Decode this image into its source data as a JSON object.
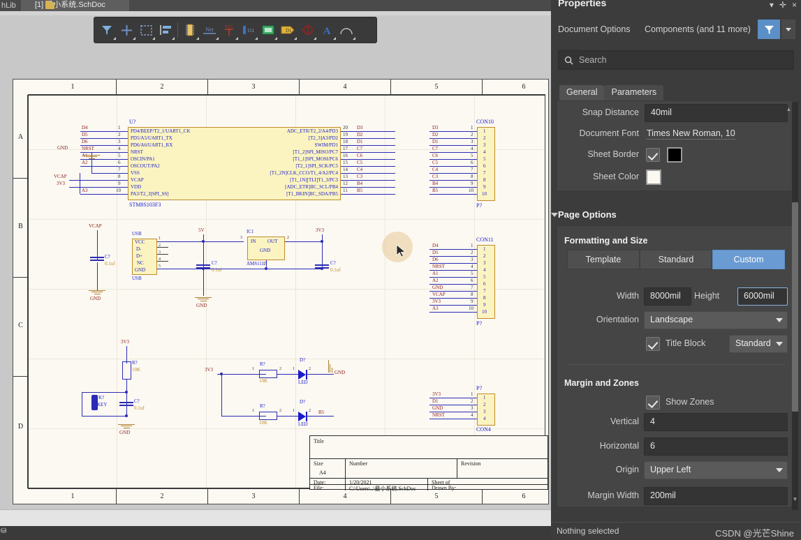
{
  "window": {
    "tab_prev": "hLib",
    "tab_active": "[1] 最小系统.SchDoc",
    "tab_folder_icon": "folder-icon"
  },
  "toolbar": {
    "buttons": [
      {
        "name": "filter-tool",
        "icon": "funnel-icon"
      },
      {
        "name": "place-crosshair-tool",
        "icon": "plus-crosshair-icon"
      },
      {
        "name": "select-area-tool",
        "icon": "dashed-rectangle-icon"
      },
      {
        "name": "align-tool",
        "icon": "align-left-icon"
      },
      {
        "name": "place-part-tool",
        "icon": "ic-chip-icon"
      },
      {
        "name": "place-net-label-tool",
        "icon": "net-label-icon"
      },
      {
        "name": "place-power-port-tool",
        "icon": "vcc-power-port-icon"
      },
      {
        "name": "place-port-tool",
        "icon": "sheet-entry-icon"
      },
      {
        "name": "place-sheet-symbol-tool",
        "icon": "sheet-symbol-icon"
      },
      {
        "name": "place-designator-tool",
        "icon": "designator-tag-icon"
      },
      {
        "name": "place-no-erc-tool",
        "icon": "no-erc-icon"
      },
      {
        "name": "place-text-tool",
        "icon": "text-a-icon"
      },
      {
        "name": "place-arc-tool",
        "icon": "arc-icon"
      }
    ]
  },
  "sheet": {
    "zones_top": [
      "1",
      "2",
      "3",
      "4",
      "5",
      "6"
    ],
    "zones_bottom": [
      "1",
      "2",
      "3",
      "4",
      "5",
      "6"
    ],
    "zones_left": [
      "A",
      "B",
      "C",
      "D"
    ],
    "mcu": {
      "designator": "U?",
      "part_name": "STM8S103F3",
      "left_pins": [
        {
          "num": "1",
          "label": "PD4/BEEP/T2_1/UART1_CK",
          "net": "D4"
        },
        {
          "num": "2",
          "label": "PD5/A5/UART1_TX",
          "net": "D5"
        },
        {
          "num": "3",
          "label": "PD6/A6/UART1_RX",
          "net": "D6"
        },
        {
          "num": "4",
          "label": "NRST",
          "net": "NRST"
        },
        {
          "num": "5",
          "label": "OSCIN/PA1",
          "net": "A1"
        },
        {
          "num": "6",
          "label": "OSCOUT/PA2",
          "net": "A2"
        },
        {
          "num": "7",
          "label": "VSS",
          "net": ""
        },
        {
          "num": "8",
          "label": "VCAP",
          "net": "VCAP"
        },
        {
          "num": "9",
          "label": "VDD",
          "net": "3V3"
        },
        {
          "num": "10",
          "label": "PA3/T2_3[SPI_SS]",
          "net": "A3"
        }
      ],
      "right_pins": [
        {
          "num": "20",
          "label": "ADC_ETR/T2_2/A4/PD3",
          "net": "D3"
        },
        {
          "num": "19",
          "label": "[T2_3]A3/PD2",
          "net": "D2"
        },
        {
          "num": "18",
          "label": "SWIM/PD1",
          "net": "D1"
        },
        {
          "num": "17",
          "label": "[T1_2]SPI_MISO/PC7",
          "net": "C7"
        },
        {
          "num": "16",
          "label": "[T1_1]SPI_MOSI/PC6",
          "net": "C6"
        },
        {
          "num": "15",
          "label": "[T2_1]SPI_SCK/PC5",
          "net": "C5"
        },
        {
          "num": "14",
          "label": "[T1_2N]CLK_CCO/T1_4/A2/PC4",
          "net": "C4"
        },
        {
          "num": "13",
          "label": "[T1_1N][TLI]T1_3/PC3",
          "net": "C3"
        },
        {
          "num": "12",
          "label": "[ADC_ETR]IIC_SCL/PB4",
          "net": "B4"
        },
        {
          "num": "11",
          "label": "[T1_BKIN]IIC_SDA/PB5",
          "net": "B5"
        }
      ],
      "left_ground_label": "GND"
    },
    "con10": {
      "designator": "P?",
      "part_name": "CON10",
      "pins": [
        "1",
        "2",
        "3",
        "4",
        "5",
        "6",
        "7",
        "8",
        "9",
        "10"
      ],
      "nets": [
        "D3",
        "D2",
        "D1",
        "C7",
        "C6",
        "C5",
        "C4",
        "C3",
        "B4",
        "B5"
      ]
    },
    "con11": {
      "designator": "P?",
      "part_name": "CON11",
      "pins": [
        "1",
        "2",
        "3",
        "4",
        "5",
        "6",
        "7",
        "8",
        "9",
        "10"
      ],
      "nets": [
        "D4",
        "D5",
        "D6",
        "NRST",
        "A1",
        "A2",
        "GND",
        "VCAP",
        "3V3",
        "A3"
      ]
    },
    "con4": {
      "designator": "P?",
      "part_name": "CON4",
      "pins": [
        "1",
        "2",
        "3",
        "4"
      ],
      "nets": [
        "3V3",
        "D1",
        "GND",
        "NRST"
      ]
    },
    "usb": {
      "designator": "USB",
      "part_name": "USB",
      "pins": [
        {
          "num": "1",
          "label": "VCC"
        },
        {
          "num": "2",
          "label": "D-"
        },
        {
          "num": "3",
          "label": "D+"
        },
        {
          "num": "4",
          "label": "NC"
        },
        {
          "num": "5",
          "label": "GND"
        }
      ]
    },
    "regulator": {
      "designator": "IC1",
      "part_name": "AMS1117",
      "pin_in": "IN",
      "pin_out": "OUT",
      "pin_gnd": "GND",
      "num_in": "3",
      "num_out": "2",
      "num_gnd": "1"
    },
    "power_nets": {
      "vcap": "VCAP",
      "gnd": "GND",
      "v5": "5V",
      "v33": "3V3"
    },
    "caps": [
      {
        "designator": "C?",
        "value": "0.1uf"
      },
      {
        "designator": "C?",
        "value": "0.1uf"
      },
      {
        "designator": "C?",
        "value": "0.1uf"
      },
      {
        "designator": "C?",
        "value": "0.1uf"
      }
    ],
    "reset_circuit": {
      "resistor_designator": "R?",
      "resistor_value": "10K",
      "cap_designator": "C?",
      "cap_value": "0.1uf",
      "switch_designator": "K?",
      "switch_name": "KEY",
      "rail": "3V3",
      "gnd": "GND"
    },
    "led_circuits": [
      {
        "rail": "3V3",
        "res_designator": "R?",
        "res_value": "10K",
        "led_designator": "D?",
        "led_name": "LED",
        "out_net": "GND",
        "pin_a": "1",
        "pin_b": "2",
        "rpin_a": "1",
        "rpin_b": "2"
      },
      {
        "rail": "3V3",
        "res_designator": "R?",
        "res_value": "10K",
        "led_designator": "D?",
        "led_name": "LED",
        "out_net": "B5",
        "pin_a": "1",
        "pin_b": "2",
        "rpin_a": "1",
        "rpin_b": "2"
      }
    ],
    "title_block": {
      "title_lbl": "Title",
      "size_lbl": "Size",
      "size_val": "A4",
      "number_lbl": "Number",
      "revision_lbl": "Revision",
      "date_lbl": "Date:",
      "date_val": "1/20/2021",
      "sheet_lbl": "Sheet  of",
      "file_lbl": "File:",
      "file_val": "C:\\Users\\..\\最小系统.SchDoc",
      "drawn_lbl": "Drawn By:"
    }
  },
  "panel": {
    "title": "Properties",
    "win_minimize": "▾",
    "win_pin": "pin-icon",
    "win_close": "×",
    "tabs": [
      {
        "label": "Document Options"
      },
      {
        "label": "Components (and 11 more)"
      }
    ],
    "filter_icon": "funnel-icon",
    "filter_dropdown_icon": "chevron-down-icon",
    "search": {
      "icon": "search-icon",
      "placeholder": "Search"
    },
    "subtabs": [
      {
        "label": "General",
        "selected": true
      },
      {
        "label": "Parameters",
        "selected": false
      }
    ],
    "general": {
      "snap_distance_label": "Snap Distance",
      "snap_distance_value": "40mil",
      "document_font_label": "Document Font",
      "document_font_value": "Times New Roman, 10",
      "sheet_border_label": "Sheet Border",
      "sheet_border_checked": true,
      "sheet_border_color": "#000000",
      "sheet_color_label": "Sheet Color",
      "sheet_color": "#fbf9f2"
    },
    "page_options": {
      "section_title": "Page Options",
      "formatting_title": "Formatting and Size",
      "segments": [
        {
          "label": "Template",
          "active": false
        },
        {
          "label": "Standard",
          "active": false
        },
        {
          "label": "Custom",
          "active": true
        }
      ],
      "width_label": "Width",
      "width_value": "8000mil",
      "height_label": "Height",
      "height_value": "6000mil",
      "orientation_label": "Orientation",
      "orientation_value": "Landscape",
      "title_block_label": "Title Block",
      "title_block_checked": true,
      "title_block_style": "Standard",
      "margin_title": "Margin and Zones",
      "show_zones_label": "Show Zones",
      "show_zones_checked": true,
      "vertical_label": "Vertical",
      "vertical_value": "4",
      "horizontal_label": "Horizontal",
      "horizontal_value": "6",
      "origin_label": "Origin",
      "origin_value": "Upper Left",
      "margin_width_label": "Margin Width",
      "margin_width_value": "200mil"
    },
    "status": "Nothing selected",
    "watermark": "CSDN @光芒Shine",
    "accent_color": "#6a9bd2"
  }
}
